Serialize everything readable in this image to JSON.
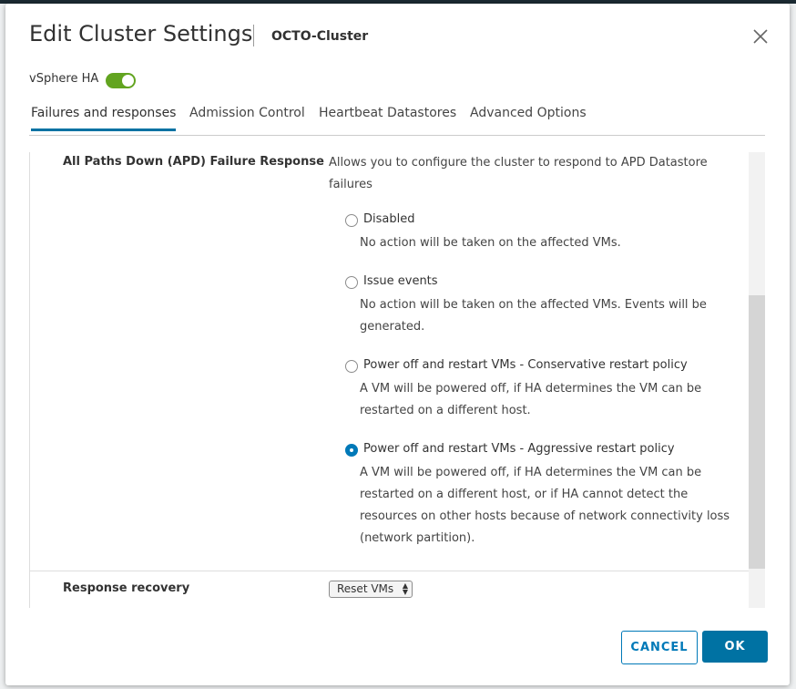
{
  "dialog": {
    "title": "Edit Cluster Settings",
    "subtitle": "OCTO-Cluster",
    "close_icon": "close-icon"
  },
  "ha": {
    "label": "vSphere HA",
    "enabled": true
  },
  "tabs": [
    {
      "label": "Failures and responses",
      "active": true
    },
    {
      "label": "Admission Control",
      "active": false
    },
    {
      "label": "Heartbeat Datastores",
      "active": false
    },
    {
      "label": "Advanced Options",
      "active": false
    }
  ],
  "apd": {
    "label": "All Paths Down (APD) Failure Response",
    "description": "Allows you to configure the cluster to respond to APD Datastore failures",
    "options": [
      {
        "label": "Disabled",
        "description": "No action will be taken on the affected VMs.",
        "selected": false
      },
      {
        "label": "Issue events",
        "description": "No action will be taken on the affected VMs. Events will be generated.",
        "selected": false
      },
      {
        "label": "Power off and restart VMs - Conservative restart policy",
        "description": "A VM will be powered off, if HA determines the VM can be restarted on a different host.",
        "selected": false
      },
      {
        "label": "Power off and restart VMs - Aggressive restart policy",
        "description": "A VM will be powered off, if HA determines the VM can be restarted on a different host, or if HA cannot detect the resources on other hosts because of network connectivity loss (network partition).",
        "selected": true
      }
    ]
  },
  "recovery": {
    "label": "Response recovery",
    "value": "Reset VMs"
  },
  "buttons": {
    "cancel": "CANCEL",
    "ok": "OK"
  },
  "colors": {
    "accent": "#0072a3",
    "toggle_on": "#62a420"
  }
}
